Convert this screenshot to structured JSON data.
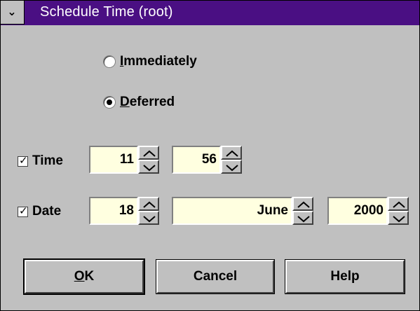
{
  "window": {
    "title": "Schedule Time (root)",
    "system_menu_glyph": "⌄"
  },
  "schedule": {
    "options": [
      {
        "label_underline": "I",
        "label_rest": "mmediately",
        "selected": false
      },
      {
        "label_underline": "D",
        "label_rest": "eferred",
        "selected": true
      }
    ]
  },
  "time": {
    "label": "Time",
    "checked": true,
    "hour": "11",
    "minute": "56"
  },
  "date": {
    "label": "Date",
    "checked": true,
    "day": "18",
    "month": "June",
    "year": "2000"
  },
  "buttons": {
    "ok_underline": "O",
    "ok_rest": "K",
    "cancel": "Cancel",
    "help": "Help"
  },
  "colors": {
    "titlebar": "#4a0f83",
    "field_bg": "#ffffe0",
    "dialog_bg": "#c0c0c0"
  }
}
